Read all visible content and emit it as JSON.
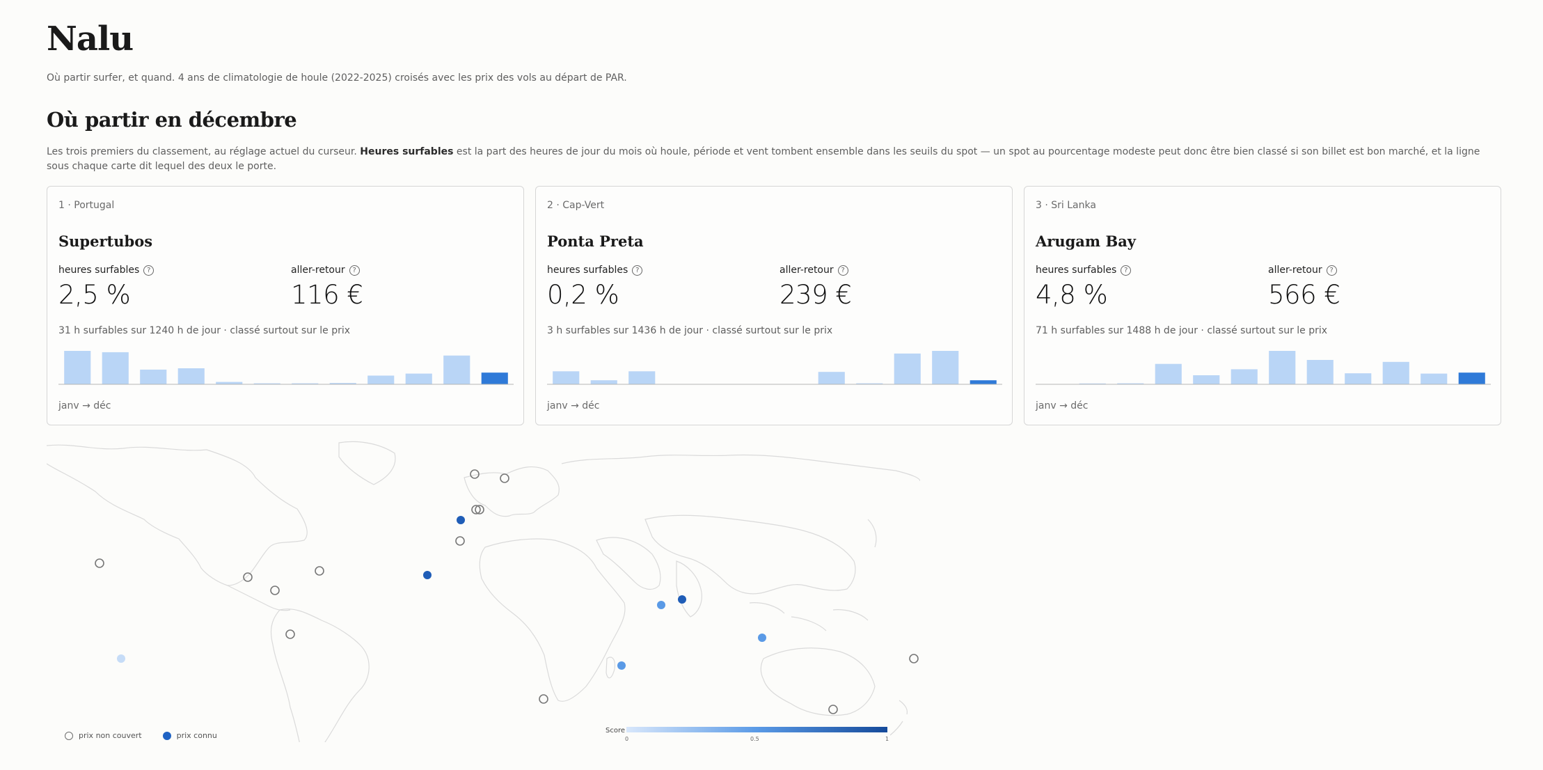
{
  "app": {
    "title": "Nalu",
    "subtitle": "Où partir surfer, et quand. 4 ans de climatologie de houle (2022-2025) croisés avec les prix des vols au départ de PAR."
  },
  "section": {
    "title": "Où partir en décembre",
    "intro_part1": "Les trois premiers du classement, au réglage actuel du curseur. ",
    "intro_bold": "Heures surfables",
    "intro_part2": " est la part des heures de jour du mois où houle, période et vent tombent ensemble dans les seuils du spot — un spot au pourcentage modeste peut donc être bien classé si son billet est bon marché, et la ligne sous chaque carte dit lequel des deux le porte."
  },
  "cards": [
    {
      "rank": "1 · Portugal",
      "spot": "Supertubos",
      "surf_label": "heures surfables",
      "surf_value": "2,5 %",
      "price_label": "aller-retour",
      "price_value": "116 €",
      "note": "31 h surfables sur 1240 h de jour · classé surtout sur le prix",
      "range": "janv → déc",
      "monthly": [
        1.0,
        0.96,
        0.44,
        0.48,
        0.07,
        0.03,
        0.03,
        0.04,
        0.26,
        0.32,
        0.86,
        0.35
      ]
    },
    {
      "rank": "2 · Cap-Vert",
      "spot": "Ponta Preta",
      "surf_label": "heures surfables",
      "surf_value": "0,2 %",
      "price_label": "aller-retour",
      "price_value": "239 €",
      "note": "3 h surfables sur 1436 h de jour · classé surtout sur le prix",
      "range": "janv → déc",
      "monthly": [
        0.39,
        0.12,
        0.39,
        0,
        0,
        0,
        0,
        0.37,
        0.03,
        0.92,
        1.0,
        0.12
      ]
    },
    {
      "rank": "3 · Sri Lanka",
      "spot": "Arugam Bay",
      "surf_label": "heures surfables",
      "surf_value": "4,8 %",
      "price_label": "aller-retour",
      "price_value": "566 €",
      "note": "71 h surfables sur 1488 h de jour · classé surtout sur le prix",
      "range": "janv → déc",
      "monthly": [
        0,
        0.01,
        0.03,
        0.61,
        0.27,
        0.45,
        1.0,
        0.73,
        0.33,
        0.67,
        0.32,
        0.35
      ]
    }
  ],
  "map": {
    "legend_open": "prix non couvert",
    "legend_filled": "prix connu",
    "scale_label": "Score",
    "scale_min": "0",
    "scale_mid": "0.5",
    "scale_max": "1",
    "colors": {
      "light": "#c6dcf7",
      "mid": "#5a9ae6",
      "dark": "#1f5db7"
    }
  }
}
